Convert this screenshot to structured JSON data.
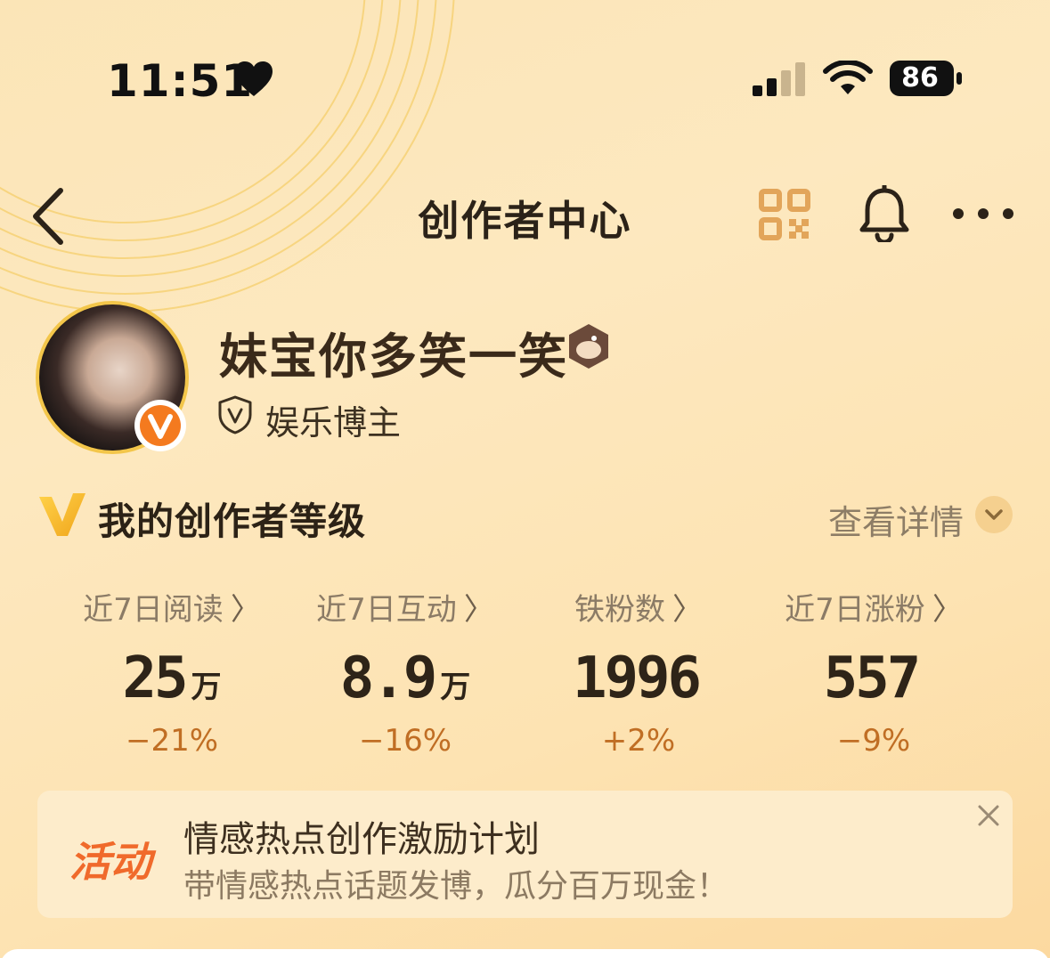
{
  "status_bar": {
    "time": "11:51",
    "battery": "86"
  },
  "nav": {
    "title": "创作者中心"
  },
  "profile": {
    "username": "妹宝你多笑一笑",
    "role": "娱乐博主"
  },
  "level": {
    "title": "我的创作者等级",
    "detail_label": "查看详情"
  },
  "stats": [
    {
      "label": "近7日阅读",
      "value": "25",
      "unit": "万",
      "change": "−21%"
    },
    {
      "label": "近7日互动",
      "value": "8.9",
      "unit": "万",
      "change": "−16%"
    },
    {
      "label": "铁粉数",
      "value": "1996",
      "unit": "",
      "change": "+2%"
    },
    {
      "label": "近7日涨粉",
      "value": "557",
      "unit": "",
      "change": "−9%"
    }
  ],
  "activity": {
    "tag": "活动",
    "title": "情感热点创作激励计划",
    "subtitle": "带情感热点话题发博，瓜分百万现金！"
  },
  "colors": {
    "accent_orange": "#f06a2b",
    "change_color": "#c06e24",
    "verified_orange": "#f47a1f"
  }
}
